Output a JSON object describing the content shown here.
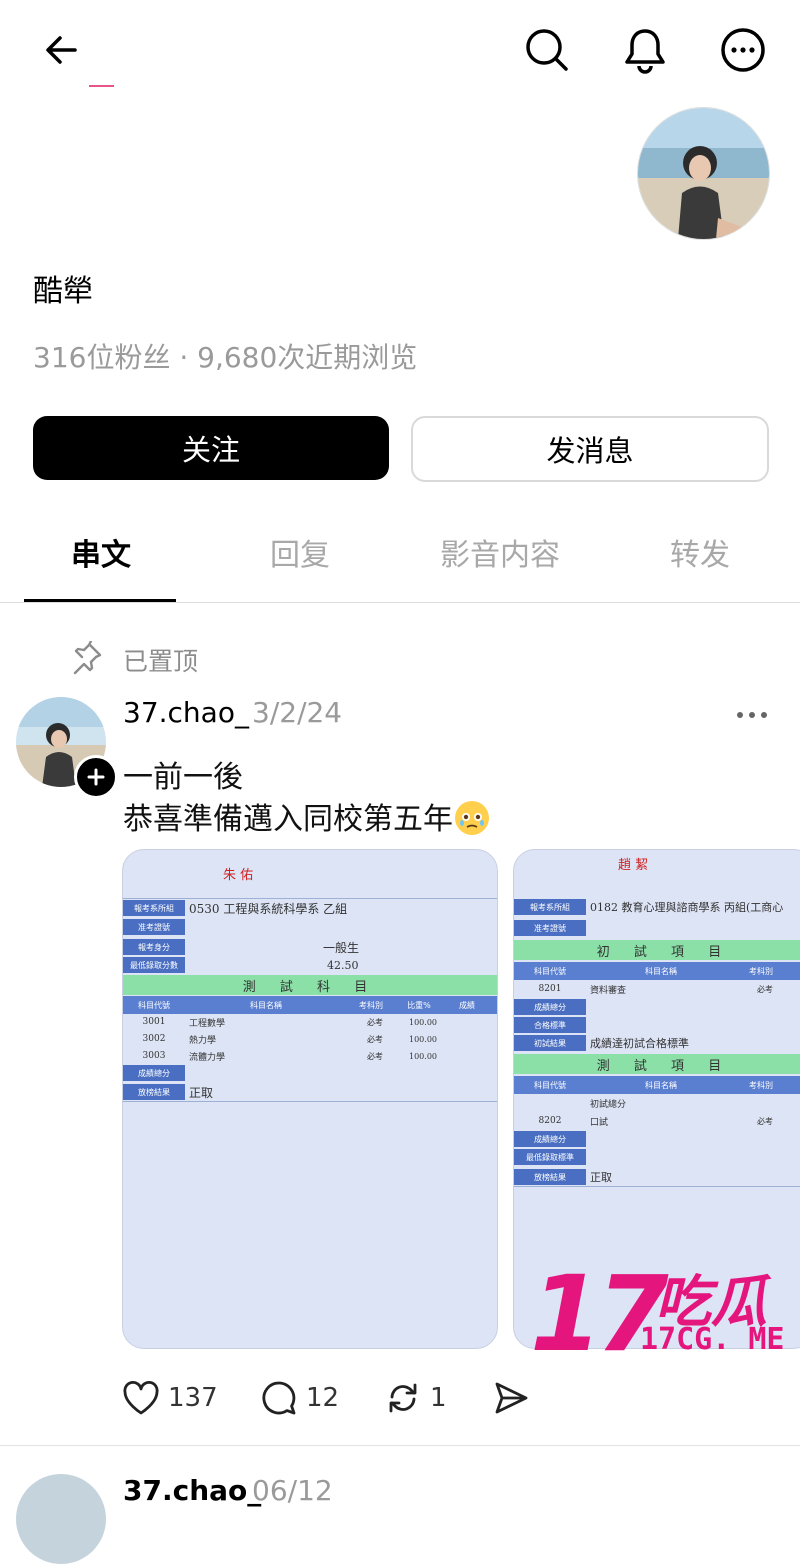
{
  "header": {
    "back_icon": "arrow-left-icon",
    "search_icon": "search-icon",
    "bell_icon": "bell-icon",
    "more_icon": "more-circle-icon"
  },
  "profile": {
    "display_name": "酷犖",
    "stats": "316位粉丝 · 9,680次近期浏览",
    "follow_label": "关注",
    "message_label": "发消息"
  },
  "tabs": [
    {
      "label": "串文",
      "active": true
    },
    {
      "label": "回复",
      "active": false
    },
    {
      "label": "影音内容",
      "active": false
    },
    {
      "label": "转发",
      "active": false
    }
  ],
  "post": {
    "pinned_label": "已置顶",
    "username": "37.chao_",
    "date": "3/2/24",
    "line1": "一前一後",
    "line2": "恭喜準備邁入同校第五年",
    "image1": {
      "name": "朱 佑",
      "dept_label": "報考系所組",
      "dept_value": "0530 工程與系統科學系 乙組",
      "id_label": "准考證號",
      "status_label": "報考身分",
      "status_value": "一般生",
      "min_label": "最低錄取分數",
      "min_value": "42.50",
      "section_title": "測 試 科 目",
      "col_code": "科目代號",
      "col_name": "科目名稱",
      "col_type": "考科別",
      "col_ratio": "比重%",
      "col_score": "成績",
      "subjects": [
        {
          "code": "3001",
          "name": "工程數學",
          "type": "必考",
          "ratio": "100.00"
        },
        {
          "code": "3002",
          "name": "熱力學",
          "type": "必考",
          "ratio": "100.00"
        },
        {
          "code": "3003",
          "name": "流體力學",
          "type": "必考",
          "ratio": "100.00"
        }
      ],
      "total_label": "成績總分",
      "result_label": "放榜結果",
      "result_value": "正取"
    },
    "image2": {
      "name": "趙 絜",
      "dept_label": "報考系所組",
      "dept_value": "0182 教育心理與諮商學系 丙組(工商心",
      "id_label": "准考證號",
      "section1_title": "初 試 項 目",
      "col_code": "科目代號",
      "col_name": "科目名稱",
      "col_type": "考科別",
      "row1_code": "8201",
      "row1_name": "資料審查",
      "row1_type": "必考",
      "total_label": "成績總分",
      "pass_label": "合格標準",
      "first_result_label": "初試結果",
      "first_result_value": "成績達初試合格標準",
      "section2_title": "測 試 項 目",
      "row2_name": "初試總分",
      "row3_code": "8202",
      "row3_name": "口試",
      "row3_type": "必考",
      "total2_label": "成績總分",
      "min_label": "最低錄取標準",
      "result_label": "放榜結果",
      "result_value": "正取"
    },
    "watermark_big": "17",
    "watermark_cn": "吃瓜",
    "watermark_url": "17CG. ME",
    "likes": "137",
    "comments": "12",
    "reposts": "1"
  },
  "next_post": {
    "username": "37.chao_",
    "date": "06/12"
  }
}
